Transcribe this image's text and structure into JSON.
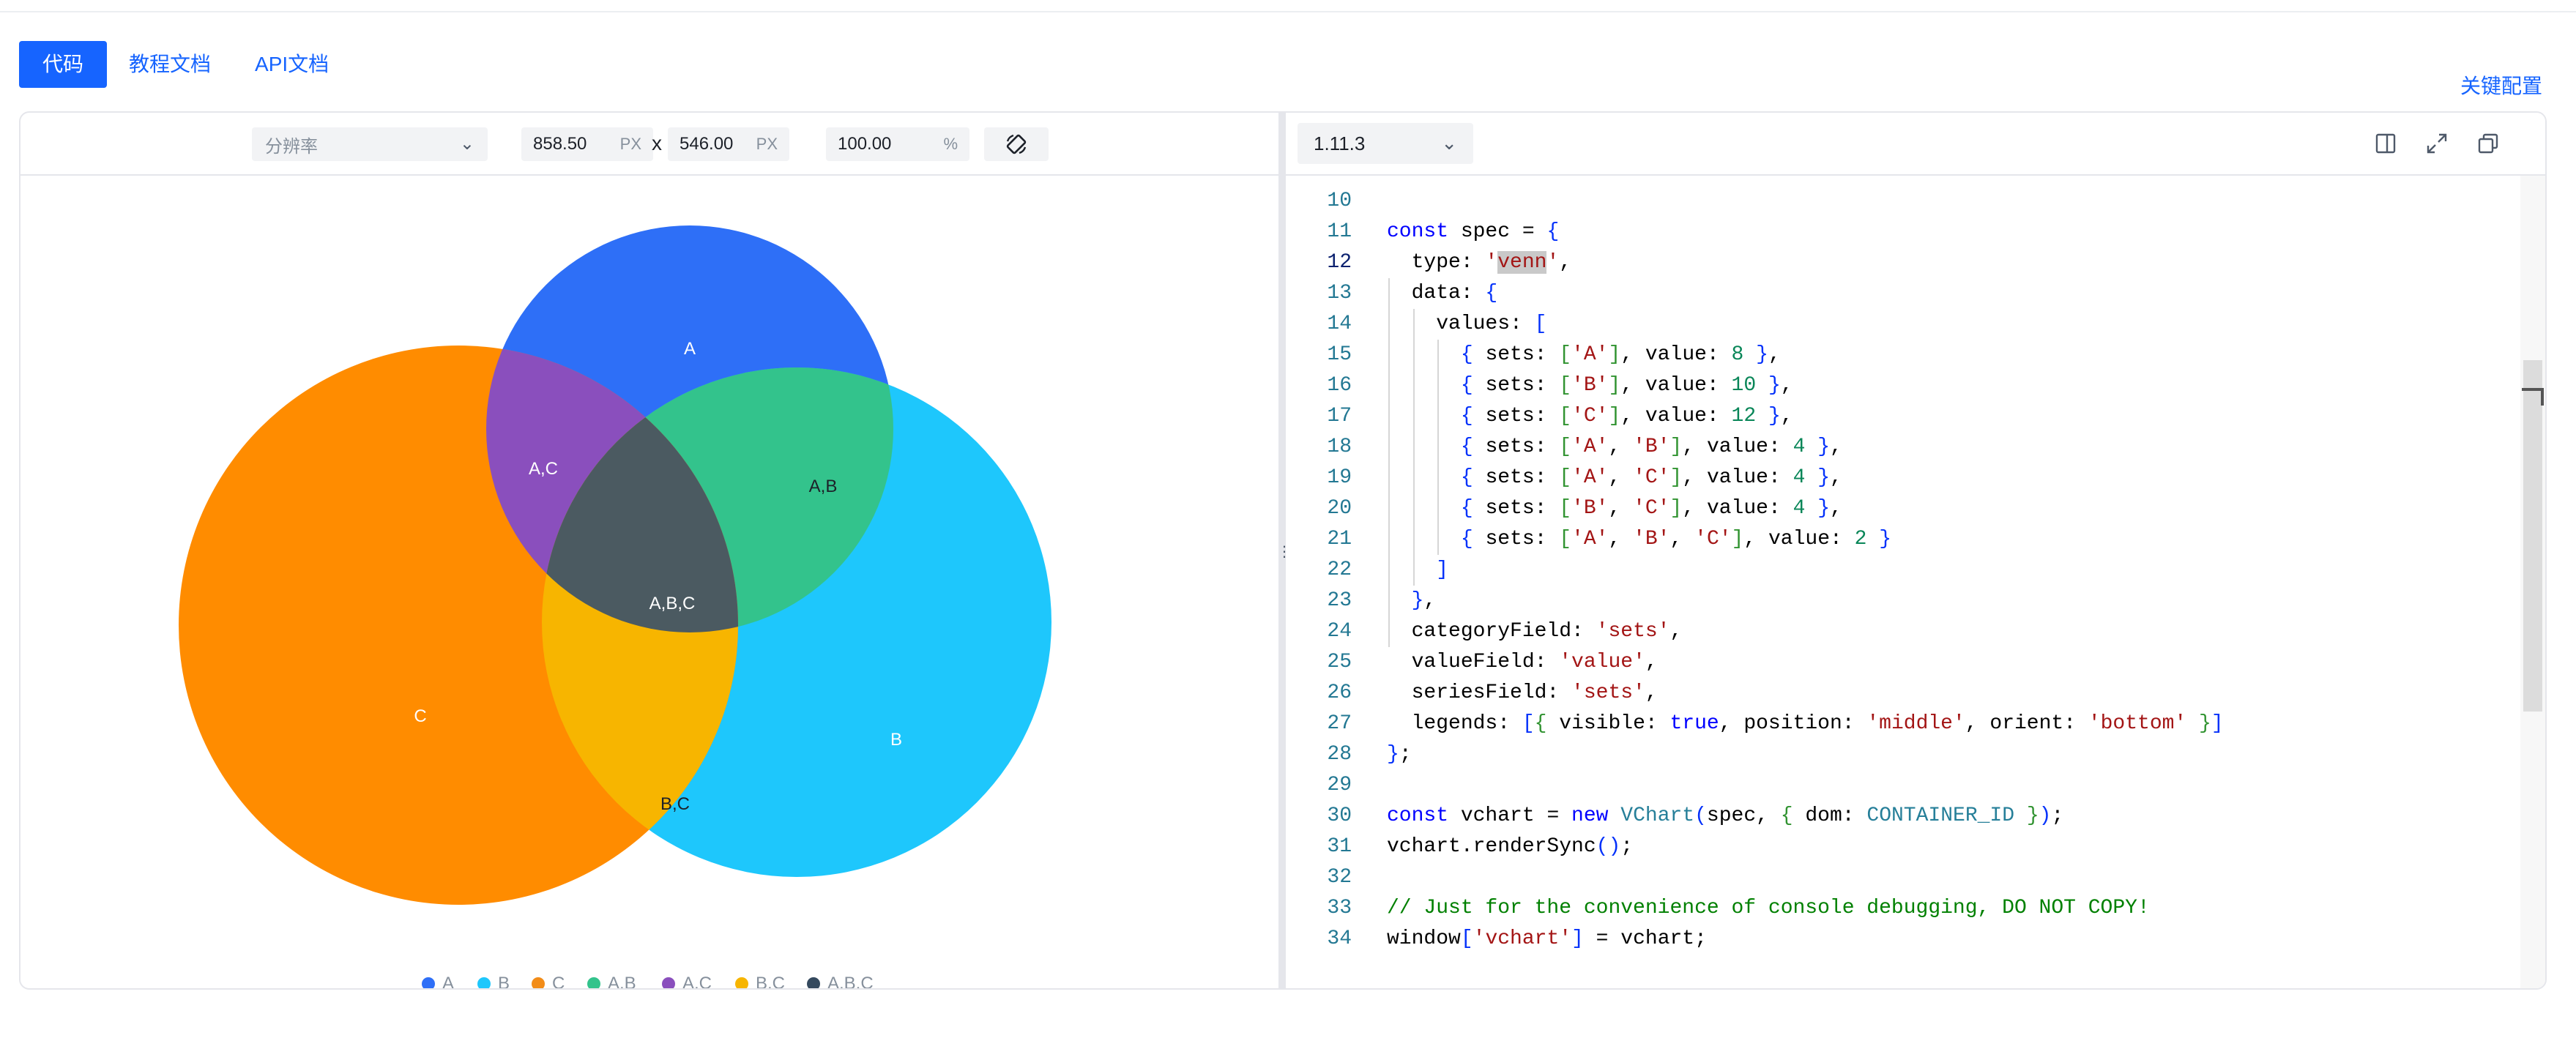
{
  "tabs": [
    {
      "label": "代码",
      "active": true
    },
    {
      "label": "教程文档",
      "active": false
    },
    {
      "label": "API文档",
      "active": false
    }
  ],
  "key_config_label": "关键配置",
  "preview_toolbar": {
    "resolution_placeholder": "分辨率",
    "width": "858.50",
    "height": "546.00",
    "unit": "PX",
    "times": "x",
    "zoom": "100.00",
    "zoom_unit": "%"
  },
  "editor_toolbar": {
    "version": "1.11.3"
  },
  "colors": {
    "accent": "#1664ff",
    "A": "#2e6ff7",
    "B": "#1ec7fc",
    "C": "#ff8c00",
    "AB": "#33c38c",
    "AC": "#8a4fbd",
    "BC": "#f7b500",
    "ABC": "#4b5a61"
  },
  "chart_data": {
    "type": "venn",
    "sets": [
      {
        "sets": [
          "A"
        ],
        "value": 8,
        "label": "A"
      },
      {
        "sets": [
          "B"
        ],
        "value": 10,
        "label": "B"
      },
      {
        "sets": [
          "C"
        ],
        "value": 12,
        "label": "C"
      },
      {
        "sets": [
          "A",
          "B"
        ],
        "value": 4,
        "label": "A,B"
      },
      {
        "sets": [
          "A",
          "C"
        ],
        "value": 4,
        "label": "A,C"
      },
      {
        "sets": [
          "B",
          "C"
        ],
        "value": 4,
        "label": "B,C"
      },
      {
        "sets": [
          "A",
          "B",
          "C"
        ],
        "value": 2,
        "label": "A,B,C"
      }
    ],
    "legend": {
      "position": "bottom-middle",
      "items": [
        "A",
        "B",
        "C",
        "A,B",
        "A,C",
        "B,C",
        "A,B,C"
      ]
    }
  },
  "code": {
    "first_line_number": 10,
    "current_line": 12,
    "lines": [
      "",
      "const spec = {",
      "  type: 'venn',",
      "  data: {",
      "    values: [",
      "      { sets: ['A'], value: 8 },",
      "      { sets: ['B'], value: 10 },",
      "      { sets: ['C'], value: 12 },",
      "      { sets: ['A', 'B'], value: 4 },",
      "      { sets: ['A', 'C'], value: 4 },",
      "      { sets: ['B', 'C'], value: 4 },",
      "      { sets: ['A', 'B', 'C'], value: 2 }",
      "    ]",
      "  },",
      "  categoryField: 'sets',",
      "  valueField: 'value',",
      "  seriesField: 'sets',",
      "  legends: [{ visible: true, position: 'middle', orient: 'bottom' }]",
      "};",
      "",
      "const vchart = new VChart(spec, { dom: CONTAINER_ID });",
      "vchart.renderSync();",
      "",
      "// Just for the convenience of console debugging, DO NOT COPY!",
      "window['vchart'] = vchart;"
    ]
  }
}
